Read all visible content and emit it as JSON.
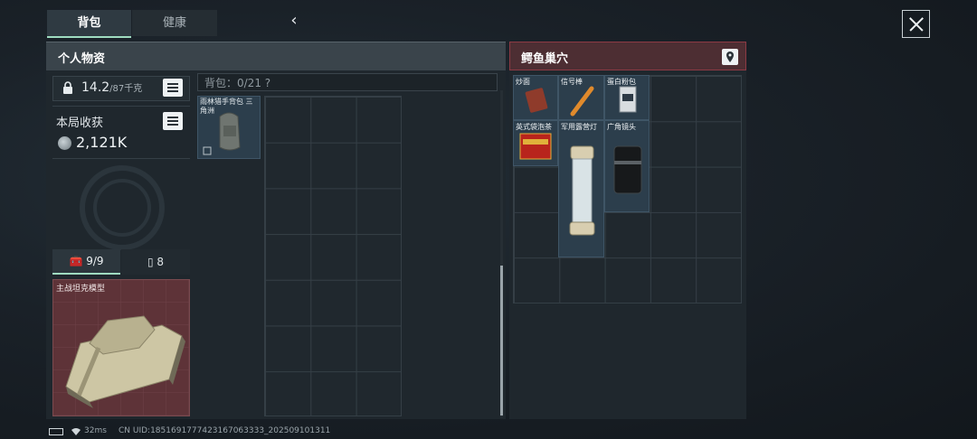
{
  "tabs": {
    "backpack": "背包",
    "health": "健康"
  },
  "personal": {
    "header": "个人物资",
    "weight_value": "14.2",
    "weight_unit": "/87千克",
    "income_label": "本局收获",
    "income_value": "2,121K",
    "tab_tools": "9/9",
    "tab_cards": "8",
    "special_item": "主战坦克模型"
  },
  "backpack": {
    "capacity": "背包：0/21",
    "help": "?",
    "item_label": "雨林猎手背包 三角洲"
  },
  "loot": {
    "header": "鳄鱼巢穴",
    "items": [
      {
        "label": "炒面"
      },
      {
        "label": "信号棒"
      },
      {
        "label": "蛋白粉包"
      },
      {
        "label": "英式袋泡茶"
      },
      {
        "label": "军用露营灯"
      },
      {
        "label": "广角镜头"
      }
    ]
  },
  "status": {
    "ping": "32ms",
    "uid": "CN UID:1851691777423167063333_202509101311"
  },
  "colors": {
    "accent": "#9fdcc0",
    "loot_header": "#4d2e33",
    "item_bg": "#2c3e4c",
    "special_bg": "#5e3338"
  }
}
